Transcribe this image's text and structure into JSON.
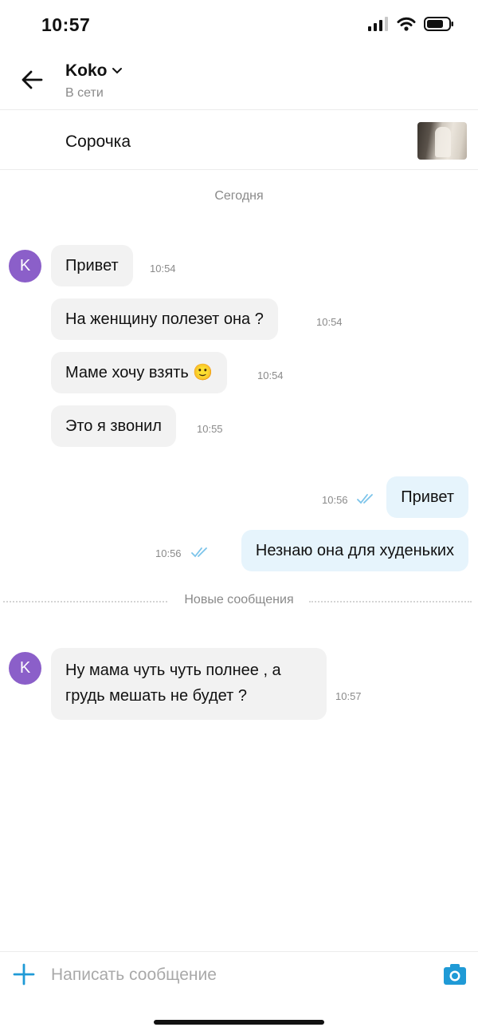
{
  "status_bar": {
    "time": "10:57"
  },
  "header": {
    "contact_name": "Koko",
    "contact_status": "В сети"
  },
  "item": {
    "title": "Сорочка"
  },
  "day_divider": "Сегодня",
  "messages": [
    {
      "direction": "in",
      "text": "Привет",
      "time": "10:54"
    },
    {
      "direction": "in",
      "text": "На женщину полезет она ?",
      "time": "10:54"
    },
    {
      "direction": "in",
      "text": "Маме хочу взять 🙂",
      "time": "10:54"
    },
    {
      "direction": "in",
      "text": "Это я звонил",
      "time": "10:55"
    },
    {
      "direction": "out",
      "text": "Привет",
      "time": "10:56",
      "status": "read"
    },
    {
      "direction": "out",
      "text": "Незнаю она для худеньких",
      "time": "10:56",
      "status": "read"
    },
    {
      "direction": "in",
      "text": "Ну мама чуть чуть полнее , а",
      "text2": "грудь мешать не будет ?",
      "time": "10:57"
    }
  ],
  "avatar_letter": "K",
  "new_messages_divider": "Новые сообщения",
  "composer": {
    "placeholder": "Написать сообщение"
  },
  "colors": {
    "accent": "#1f9ad6",
    "avatar": "#8b5fc9",
    "incoming_bubble": "#f2f2f2",
    "outgoing_bubble": "#e6f4fc",
    "read_ticks": "#7cc4ea"
  }
}
